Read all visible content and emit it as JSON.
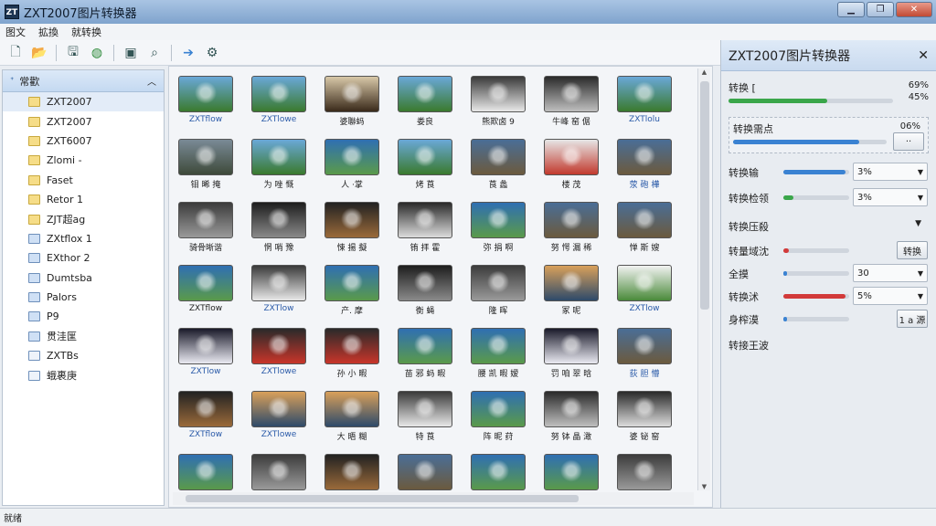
{
  "window": {
    "title": "ZXT2007图片转换器",
    "app_icon": "ZT"
  },
  "menu": [
    "图文",
    "拡換",
    "就转换"
  ],
  "toolbar_icons": [
    "new-file-icon",
    "open-folder-icon",
    "save-icon",
    "globe-icon",
    "monitor-icon",
    "search-icon",
    "arrow-right-icon",
    "settings-icon"
  ],
  "sidebar": {
    "header": "常歡",
    "items": [
      {
        "label": "ZXT2007",
        "icon": "folder",
        "selected": true
      },
      {
        "label": "ZXT2007",
        "icon": "folder"
      },
      {
        "label": "ZXT6007",
        "icon": "folder"
      },
      {
        "label": "Zlomi -",
        "icon": "folder"
      },
      {
        "label": "Faset",
        "icon": "folder"
      },
      {
        "label": "Retor 1",
        "icon": "folder"
      },
      {
        "label": "ZJT超ag",
        "icon": "folder"
      },
      {
        "label": "ZXtflox 1",
        "icon": "folder-blue"
      },
      {
        "label": "EXthor 2",
        "icon": "folder-blue"
      },
      {
        "label": "Dumtsba",
        "icon": "folder-blue"
      },
      {
        "label": "Palors",
        "icon": "folder-blue"
      },
      {
        "label": "P9",
        "icon": "folder-blue"
      },
      {
        "label": "贯洼匩",
        "icon": "folder-blue"
      },
      {
        "label": "ZXTBs",
        "icon": "document"
      },
      {
        "label": "蛾裹庚",
        "icon": "document"
      }
    ]
  },
  "grid": {
    "rows": [
      [
        {
          "c": "ZXTflow",
          "t": "landscape",
          "b": true
        },
        {
          "c": "ZXTlowe",
          "t": "landscape",
          "b": true
        },
        {
          "c": "婆聯蚂",
          "t": "portrait"
        },
        {
          "c": "娄良",
          "t": "landscape"
        },
        {
          "c": "熊欺卤 9",
          "t": "star"
        },
        {
          "c": "牛峰 窑 倨",
          "t": "tilt"
        },
        {
          "c": "ZXTlolu",
          "t": "landscape",
          "b": true
        }
      ],
      [
        {
          "c": "钼 晞 掩",
          "t": "road"
        },
        {
          "c": "为 唑 慨",
          "t": "landscape"
        },
        {
          "c": "人 ·掌",
          "t": "screen"
        },
        {
          "c": "烤 莨",
          "t": "landscape"
        },
        {
          "c": "莨 蠡",
          "t": "mountain"
        },
        {
          "c": "楼 茂",
          "t": "redtilt"
        },
        {
          "c": "荥 砲 樺",
          "t": "mountain",
          "b": true
        }
      ],
      [
        {
          "c": "骑骨晰谐",
          "t": "device"
        },
        {
          "c": "惘 哨 豫",
          "t": "tunnel"
        },
        {
          "c": "悚 揚 擬",
          "t": "lens"
        },
        {
          "c": "铕 拝 霍",
          "t": "circle"
        },
        {
          "c": "弥 捐 啊",
          "t": "screen"
        },
        {
          "c": "努 愕 漏 稀",
          "t": "mountain"
        },
        {
          "c": "惮 斯 嫂",
          "t": "mountain"
        }
      ],
      [
        {
          "c": "ZXTflow",
          "t": "screen"
        },
        {
          "c": "ZXTlow",
          "t": "star",
          "b": true
        },
        {
          "c": "产. 摩",
          "t": "screen"
        },
        {
          "c": "衡 蝇",
          "t": "tunnel"
        },
        {
          "c": "隆 晖",
          "t": "device"
        },
        {
          "c": "冢 呢",
          "t": "sunset"
        },
        {
          "c": "ZXTlow",
          "t": "photo",
          "b": true
        }
      ],
      [
        {
          "c": "ZXTlow",
          "t": "burst",
          "b": true
        },
        {
          "c": "ZXTlowe",
          "t": "redbox",
          "b": true
        },
        {
          "c": "孙 小 暇",
          "t": "redbox"
        },
        {
          "c": "苗 邪 蚂 暇",
          "t": "screen"
        },
        {
          "c": "腰 凯 暇 嫒",
          "t": "screen"
        },
        {
          "c": "罚 咱 翠 晗",
          "t": "burst"
        },
        {
          "c": "荻 胆 懵",
          "t": "mountain",
          "b": true
        }
      ],
      [
        {
          "c": "ZXTflow",
          "t": "lens",
          "b": true
        },
        {
          "c": "ZXTlowe",
          "t": "sunset",
          "b": true
        },
        {
          "c": "大 晤 糊",
          "t": "sunset"
        },
        {
          "c": "特 莨",
          "t": "star"
        },
        {
          "c": "阵 昵 荮",
          "t": "screen"
        },
        {
          "c": "努 钵 晶 澉",
          "t": "tilt"
        },
        {
          "c": "婆 铋 窑",
          "t": "circle"
        }
      ],
      [
        {
          "c": "",
          "t": "screen"
        },
        {
          "c": "",
          "t": "device"
        },
        {
          "c": "",
          "t": "lens"
        },
        {
          "c": "",
          "t": "mountain"
        },
        {
          "c": "",
          "t": "screen"
        },
        {
          "c": "",
          "t": "screen"
        },
        {
          "c": "",
          "t": "device"
        }
      ]
    ]
  },
  "panel": {
    "title": "ZXT2007图片转换器",
    "progress1": {
      "label": "转换 [",
      "value_a": "69%",
      "value_b": "45%",
      "fill": 0.6,
      "color": "#3aa64a"
    },
    "progress2": {
      "label": "转换需点",
      "value": "06%",
      "fill": 0.82,
      "color": "#3a82d2",
      "button": "··"
    },
    "sliders": [
      {
        "label": "转换输",
        "value": "3%",
        "fill": 0.95,
        "color": "#3a82d2",
        "type": "dropdown"
      },
      {
        "label": "转换检领",
        "value": "3%",
        "fill": 0.15,
        "color": "#3aa64a",
        "type": "dropdown"
      }
    ],
    "section": {
      "label": "转换压殺"
    },
    "sliders2": [
      {
        "label": "转量域沈",
        "value": "转换",
        "fill": 0.08,
        "color": "#d23a3a",
        "type": "button"
      },
      {
        "label": "全摸",
        "value": "30",
        "fill": 0.0,
        "color": "#3a82d2",
        "type": "dropdown"
      },
      {
        "label": "转换沭",
        "value": "5%",
        "fill": 0.95,
        "color": "#d23a3a",
        "type": "dropdown"
      },
      {
        "label": "身榨漠",
        "value": "1 a 源",
        "fill": 0.0,
        "color": "#3a82d2",
        "type": "button"
      }
    ],
    "footer": "转接王波"
  },
  "status": "就绪"
}
